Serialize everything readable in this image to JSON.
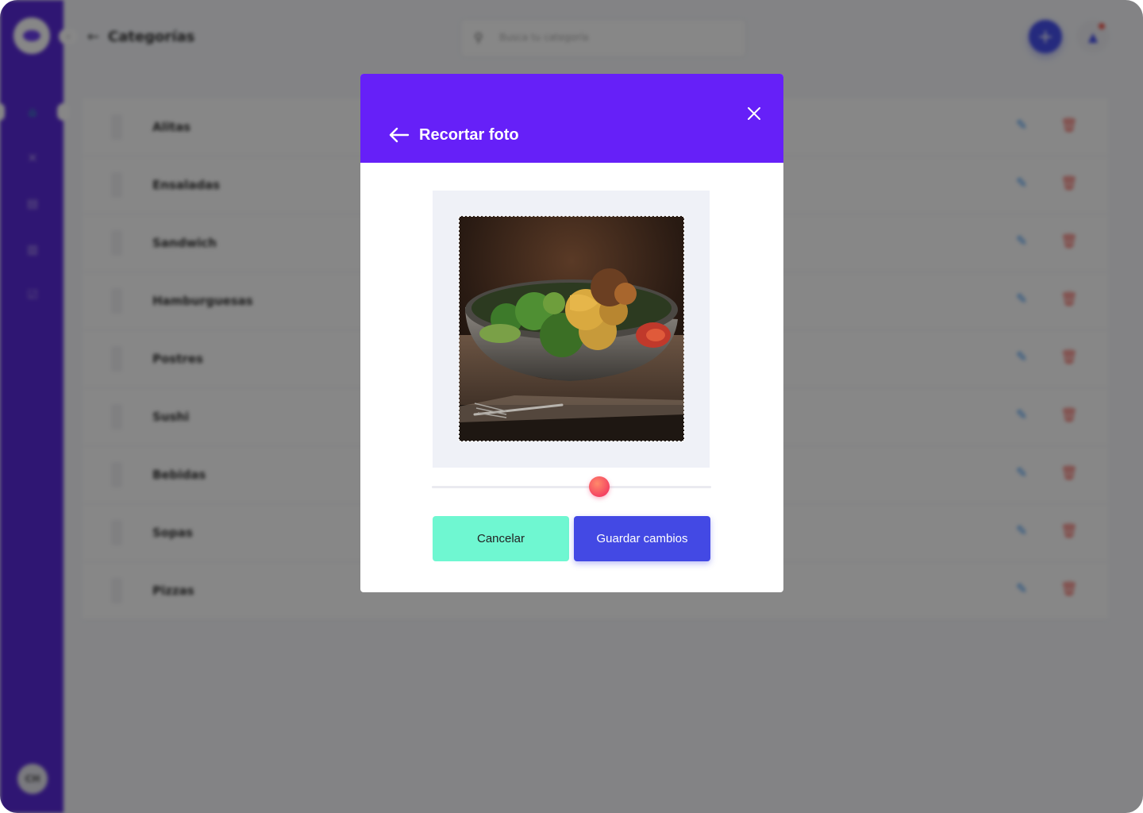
{
  "app": {
    "title": "Categorías",
    "back_glyph": "←",
    "search_placeholder": "Busca tu categoría",
    "add_glyph": "+",
    "avatar_initials": "CH",
    "categories": [
      "Alitas",
      "Ensaladas",
      "Sandwich",
      "Hamburguesas",
      "Postres",
      "Sushi",
      "Bebidas",
      "Sopas",
      "Pizzas"
    ]
  },
  "modal": {
    "title": "Recortar foto",
    "zoom": 0.6,
    "cancel_label": "Cancelar",
    "save_label": "Guardar cambios"
  },
  "colors": {
    "sidebar": "#5a2bd9",
    "modal_header": "#6620f8",
    "cancel_button": "#6ff7d1",
    "save_button": "#4349e4",
    "slider_thumb": "#f0265f",
    "edit_icon": "#2d8cf0",
    "delete_icon": "#f25c54"
  },
  "icons": {
    "back": "arrow-left-icon",
    "close": "close-icon",
    "search": "search-icon",
    "add": "plus-icon",
    "bell": "bell-icon",
    "edit": "pencil-icon",
    "delete": "trash-icon"
  }
}
